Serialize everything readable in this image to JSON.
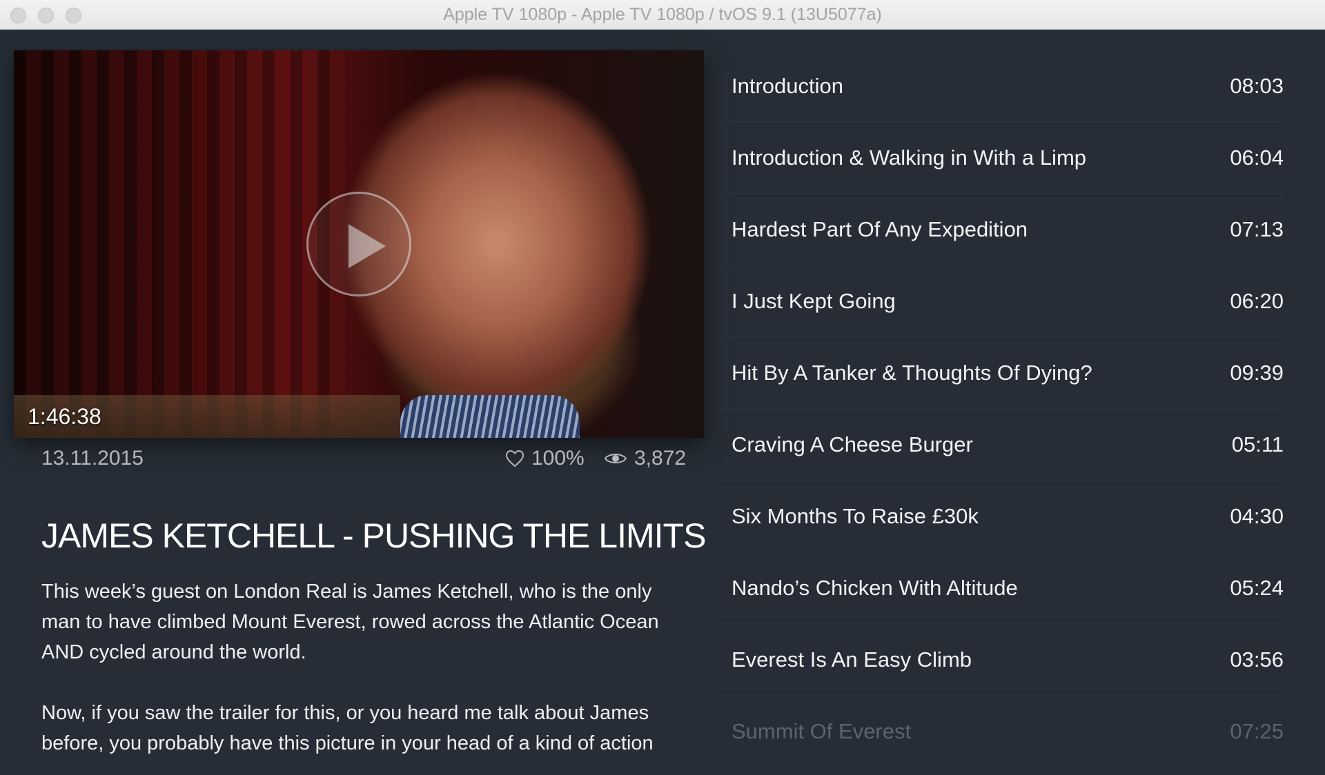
{
  "window": {
    "title": "Apple TV 1080p - Apple TV 1080p / tvOS 9.1 (13U5077a)"
  },
  "video": {
    "duration": "1:46:38",
    "date": "13.11.2015",
    "likes": "100%",
    "views": "3,872",
    "title": "JAMES KETCHELL - PUSHING THE LIMITS",
    "description": [
      "This week’s guest on London Real is James Ketchell, who is the only man to have climbed Mount Everest, rowed across the Atlantic Ocean AND cycled around the world.",
      "Now, if you saw the trailer for this, or you heard me talk about James before, you probably have this picture in your head of a kind of action hero alpha male, a sort of Hollywood c…"
    ]
  },
  "chapters": [
    {
      "title": "Introduction",
      "time": "08:03"
    },
    {
      "title": "Introduction & Walking in With a Limp",
      "time": "06:04"
    },
    {
      "title": "Hardest Part Of Any Expedition",
      "time": "07:13"
    },
    {
      "title": "I Just Kept Going",
      "time": "06:20"
    },
    {
      "title": "Hit By A Tanker & Thoughts Of Dying?",
      "time": "09:39"
    },
    {
      "title": "Craving A Cheese Burger",
      "time": "05:11"
    },
    {
      "title": "Six Months To Raise £30k",
      "time": "04:30"
    },
    {
      "title": "Nando’s Chicken With Altitude",
      "time": "05:24"
    },
    {
      "title": "Everest Is An Easy Climb",
      "time": "03:56"
    },
    {
      "title": "Summit Of Everest",
      "time": "07:25"
    }
  ],
  "icons": {
    "heart": "heart-icon",
    "eye": "eye-icon",
    "play": "play-icon"
  }
}
